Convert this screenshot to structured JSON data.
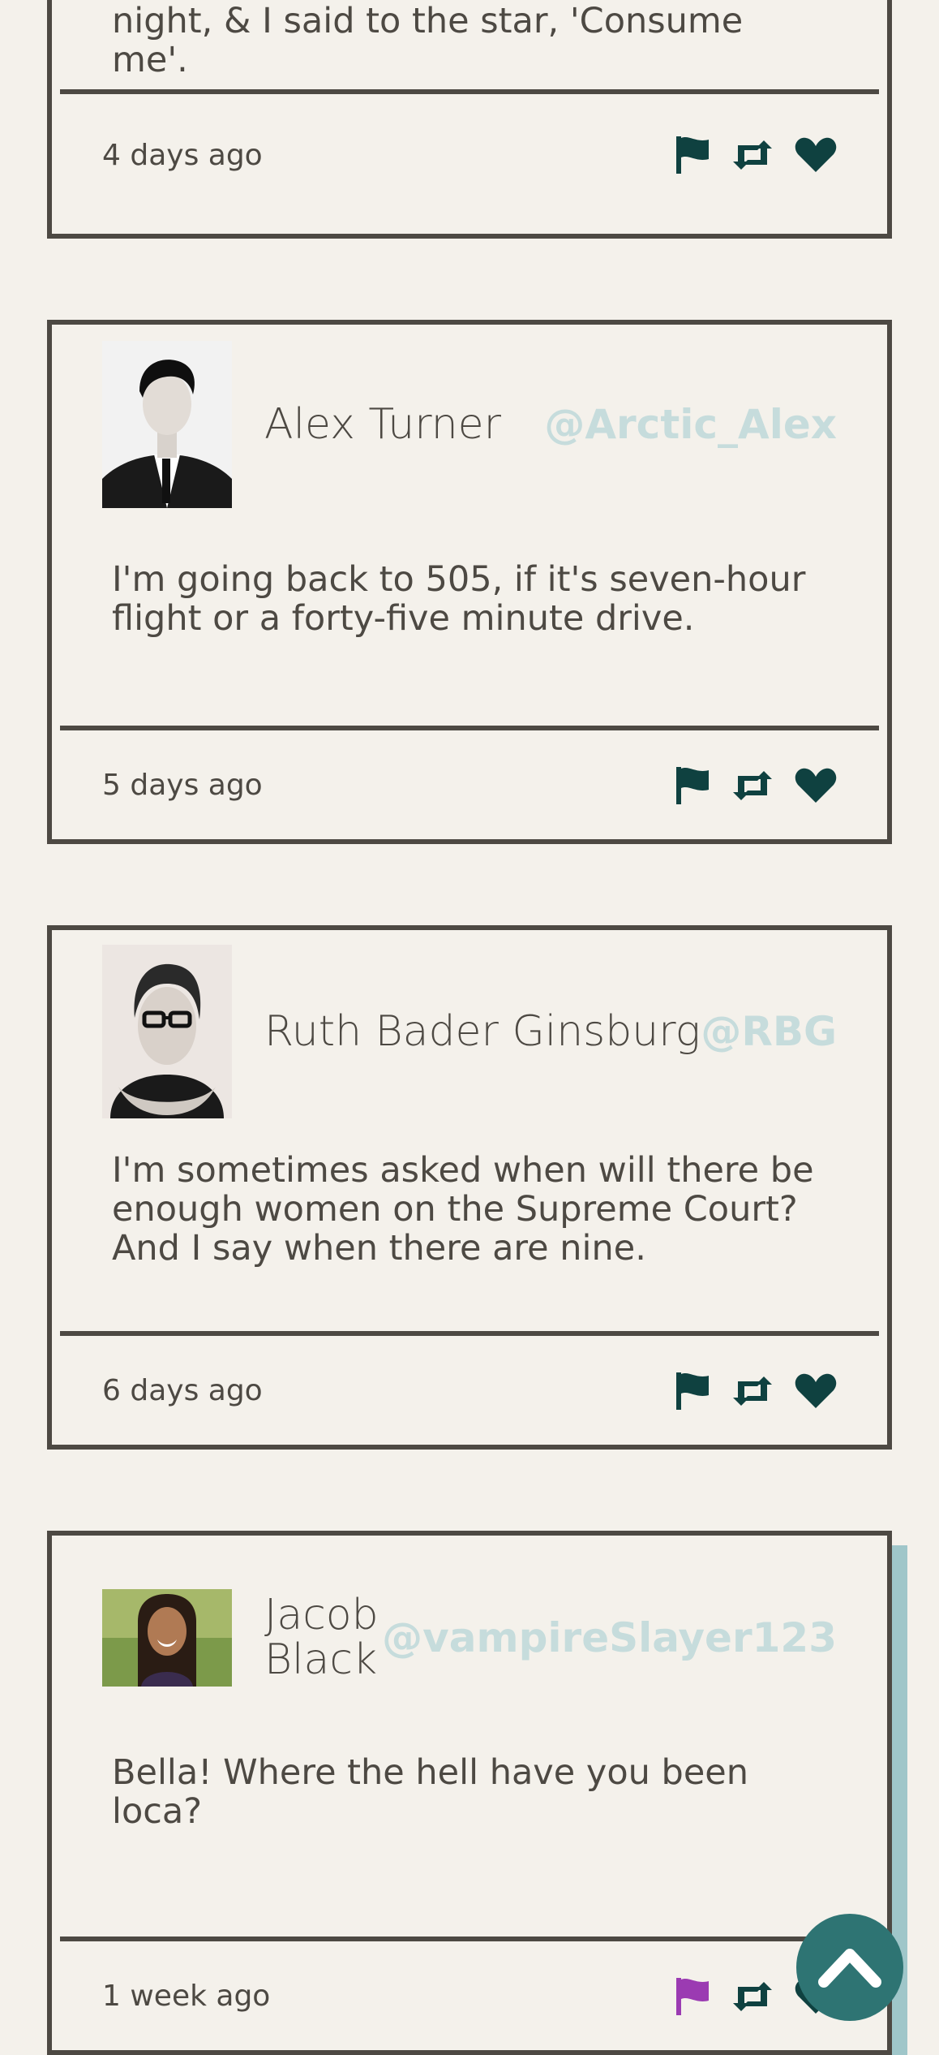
{
  "colors": {
    "background": "#f4f1eb",
    "border": "#4d4943",
    "text": "#4d4943",
    "handle": "#c6dcdc",
    "icon": "#0f4140",
    "flag_active": "#9b3bb2",
    "back_to_top": "#2e7473",
    "scroll_accent": "#9fc6c9"
  },
  "posts": [
    {
      "name": "",
      "handle": "",
      "text": "night, & I said to the star, 'Consume me'.",
      "timestamp": "4 days ago",
      "flagged": false
    },
    {
      "name": "Alex Turner",
      "handle": "@Arctic_Alex",
      "text": "I'm going back to 505, if it's seven-hour flight or a forty-five minute drive.",
      "timestamp": "5 days ago",
      "flagged": false
    },
    {
      "name": "Ruth Bader Ginsburg",
      "handle": "@RBG",
      "text": "I'm sometimes asked when will there be enough women on the Supreme Court? And I say when there are nine.",
      "timestamp": "6 days ago",
      "flagged": false
    },
    {
      "name": "Jacob Black",
      "handle": "@vampireSlayer123",
      "text": "Bella! Where the hell have you been loca?",
      "timestamp": "1 week ago",
      "flagged": true
    }
  ],
  "icons": {
    "flag": "flag-icon",
    "retweet": "retweet-icon",
    "like": "heart-icon",
    "back_to_top": "chevron-up-icon"
  }
}
